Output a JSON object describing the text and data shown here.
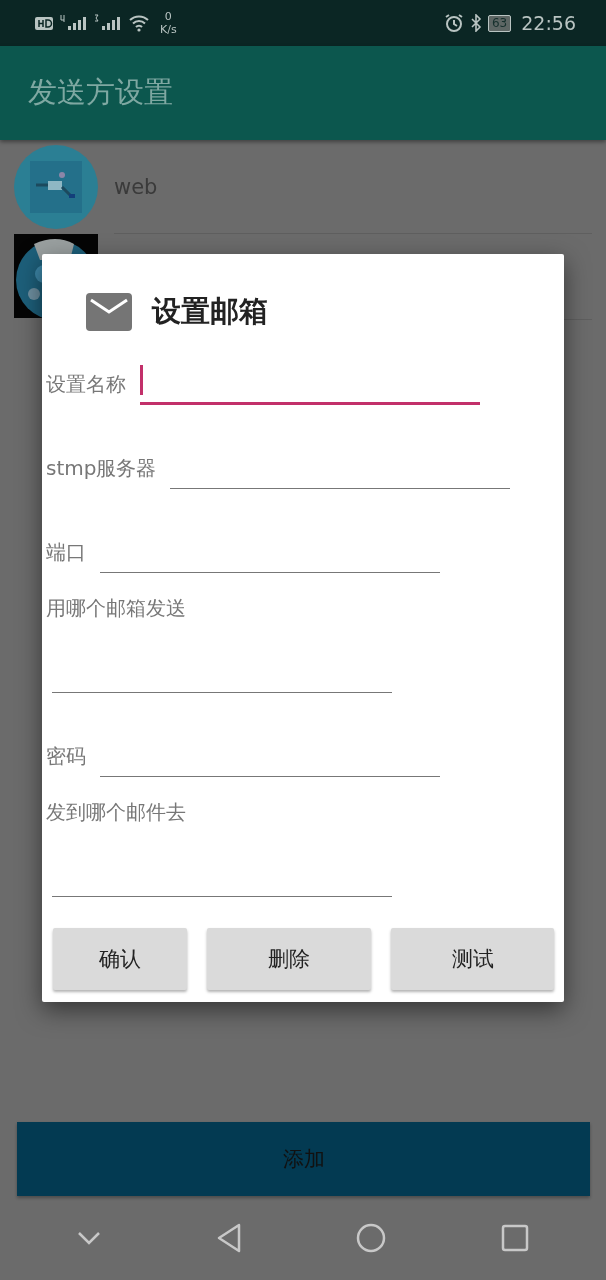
{
  "status_bar": {
    "network_speed_value": "0",
    "network_speed_unit": "K/s",
    "battery": "63",
    "time": "22:56"
  },
  "app_bar": {
    "title": "发送方设置"
  },
  "list": [
    {
      "kind": "titled",
      "title": "web"
    },
    {
      "kind": "untitled"
    }
  ],
  "dialog": {
    "title": "设置邮箱",
    "fields": [
      {
        "label": "设置名称",
        "kind": "inline",
        "focused": true
      },
      {
        "label": "stmp服务器",
        "kind": "inline",
        "focused": false
      },
      {
        "label": "端口",
        "kind": "inline",
        "focused": false
      },
      {
        "label": "用哪个邮箱发送",
        "kind": "stacked",
        "focused": false
      },
      {
        "label": "密码",
        "kind": "inline",
        "focused": false
      },
      {
        "label": "发到哪个邮件去",
        "kind": "stacked",
        "focused": false
      }
    ],
    "buttons": [
      "确认",
      "删除",
      "测试"
    ]
  },
  "add_button": "添加"
}
